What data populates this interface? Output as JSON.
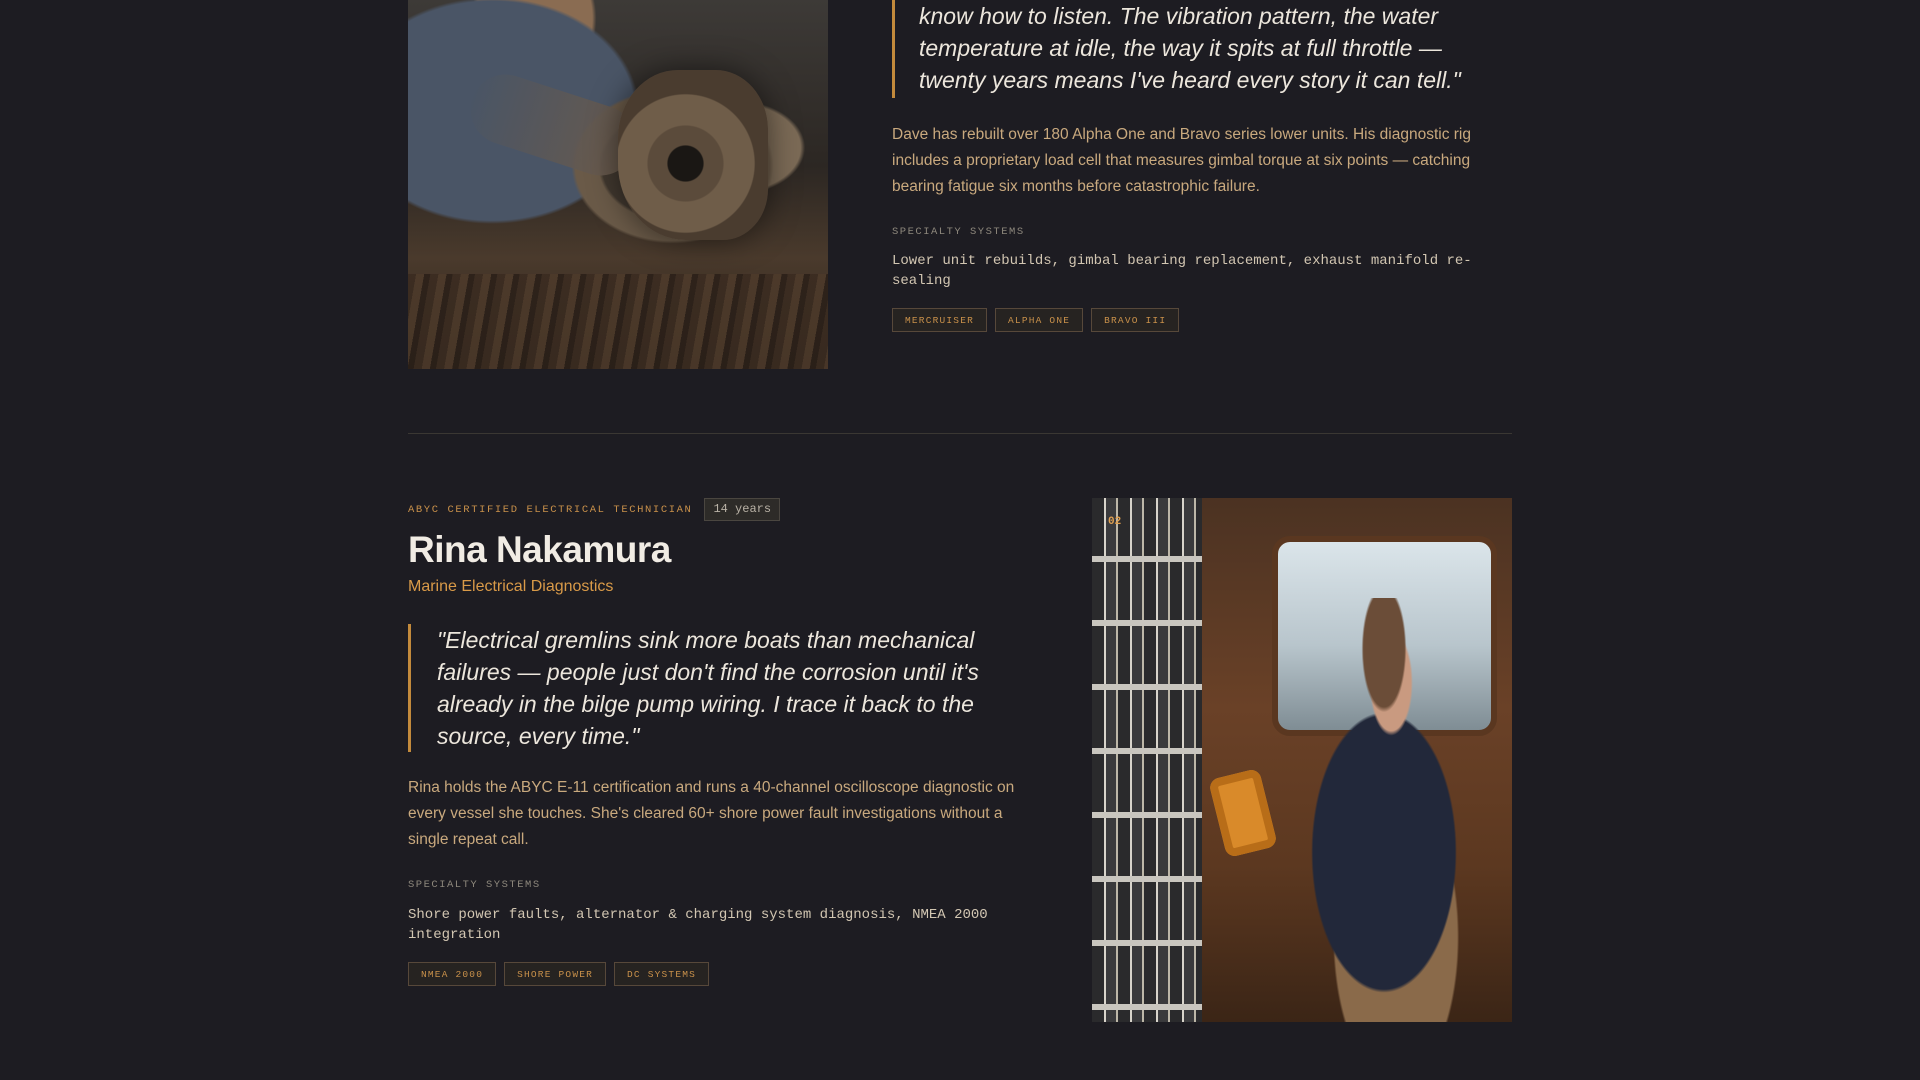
{
  "dave": {
    "quote": "know how to listen. The vibration pattern, the water temperature at idle, the way it spits at full throttle — twenty years means I've heard every story it can tell.\"",
    "bio": "Dave has rebuilt over 180 Alpha One and Bravo series lower units. His diagnostic rig includes a proprietary load cell that measures gimbal torque at six points — catching bearing fatigue six months before catastrophic failure.",
    "specialty_label": "SPECIALTY SYSTEMS",
    "specialty": "Lower unit rebuilds, gimbal bearing replacement, exhaust manifold re-sealing",
    "tags": [
      "MERCRUISER",
      "ALPHA ONE",
      "BRAVO III"
    ]
  },
  "rina": {
    "certification": "ABYC CERTIFIED ELECTRICAL TECHNICIAN",
    "years": "14 years",
    "name": "Rina Nakamura",
    "role": "Marine Electrical Diagnostics",
    "quote": "\"Electrical gremlins sink more boats than mechanical failures — people just don't find the corrosion until it's already in the bilge pump wiring. I trace it back to the source, every time.\"",
    "bio": "Rina holds the ABYC E-11 certification and runs a 40-channel oscilloscope diagnostic on every vessel she touches. She's cleared 60+ shore power fault investigations without a single repeat call.",
    "specialty_label": "SPECIALTY SYSTEMS",
    "specialty": "Shore power faults, alternator & charging system diagnosis, NMEA 2000 integration",
    "tags": [
      "NMEA 2000",
      "SHORE POWER",
      "DC SYSTEMS"
    ],
    "photo_number": "02"
  },
  "colors": {
    "background": "#1d1c22",
    "accent": "#c8904a",
    "quote_border": "#c38a3c",
    "bio_text": "#c9a97e"
  }
}
